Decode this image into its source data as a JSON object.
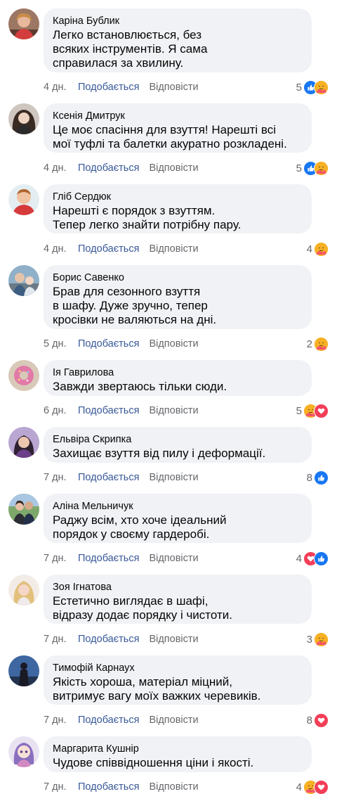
{
  "labels": {
    "like": "Подобається",
    "reply": "Відповісти"
  },
  "colors": {
    "bubble": "#f0f2f5",
    "like_link": "#385898",
    "meta": "#65676b",
    "like_react": "#1877f2",
    "love_react": "#f33e58",
    "care_react": "#f7b125"
  },
  "comments": [
    {
      "author": "Каріна Бублик",
      "text": "Легко встановлюється, без\nвсяких інструментів. Я сама\nсправилася за хвилину.",
      "time": "4 дн.",
      "reaction_count": "5",
      "reactions": [
        "like-icon",
        "care-icon"
      ]
    },
    {
      "author": "Ксенія Дмитрук",
      "text": "Це моє спасіння для взуття! Нарешті всі\nмої туфлі та балетки акуратно розкладені.",
      "time": "4 дн.",
      "reaction_count": "5",
      "reactions": [
        "like-icon",
        "care-icon"
      ]
    },
    {
      "author": "Гліб Сердюк",
      "text": "Нарешті є порядок з взуттям.\nТепер легко знайти потрібну пару.",
      "time": "4 дн.",
      "reaction_count": "4",
      "reactions": [
        "care-icon"
      ]
    },
    {
      "author": "Борис Савенко",
      "text": "Брав для сезонного взуття\nв шафу. Дуже зручно, тепер\nкросівки не валяються на дні.",
      "time": "5 дн.",
      "reaction_count": "2",
      "reactions": [
        "care-icon"
      ]
    },
    {
      "author": "Ія Гаврилова",
      "text": "Завжди звертаюсь тільки сюди.",
      "time": "6 дн.",
      "reaction_count": "5",
      "reactions": [
        "care-icon",
        "love-icon"
      ]
    },
    {
      "author": "Ельвіра Скрипка",
      "text": "Захищає взуття від пилу і деформації.",
      "time": "7 дн.",
      "reaction_count": "8",
      "reactions": [
        "like-icon"
      ]
    },
    {
      "author": "Аліна Мельничук",
      "text": "Раджу всім, хто хоче ідеальний\nпорядок у своєму гардеробі.",
      "time": "7 дн.",
      "reaction_count": "4",
      "reactions": [
        "love-icon",
        "like-icon"
      ]
    },
    {
      "author": "Зоя Ігнатова",
      "text": "Естетично виглядає в шафі,\nвідразу додає порядку і чистоти.",
      "time": "7 дн.",
      "reaction_count": "3",
      "reactions": [
        "care-icon"
      ]
    },
    {
      "author": "Тимофій Карнаух",
      "text": "Якість хороша, матеріал міцний,\nвитримує вагу моїх важких черевиків.",
      "time": "7 дн.",
      "reaction_count": "8",
      "reactions": [
        "love-icon"
      ]
    },
    {
      "author": "Маргарита Кушнір",
      "text": "Чудове співвідношення ціни і якості.",
      "time": "7 дн.",
      "reaction_count": "4",
      "reactions": [
        "care-icon",
        "love-icon"
      ]
    }
  ]
}
